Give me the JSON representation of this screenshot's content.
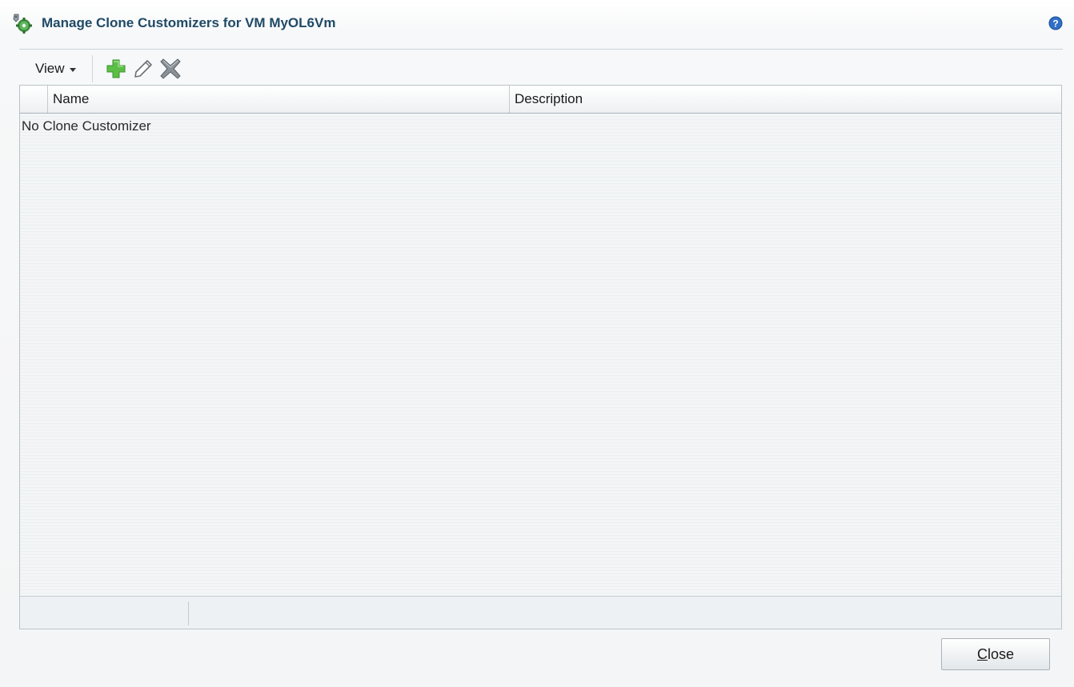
{
  "dialog": {
    "title": "Manage Clone Customizers for VM MyOL6Vm",
    "title_icon": "clone-customizer-icon",
    "help_icon": "help-icon"
  },
  "toolbar": {
    "view_label": "View",
    "add_icon": "add-icon",
    "edit_icon": "edit-pencil-icon",
    "delete_icon": "delete-icon"
  },
  "table": {
    "columns": [
      "Name",
      "Description"
    ],
    "empty_message": "No Clone Customizer"
  },
  "footer": {
    "close_mnemonic": "C",
    "close_rest": "lose"
  },
  "colors": {
    "title": "#1f4a66",
    "add_green": "#4caf3a",
    "help_blue": "#2f6fc6"
  }
}
